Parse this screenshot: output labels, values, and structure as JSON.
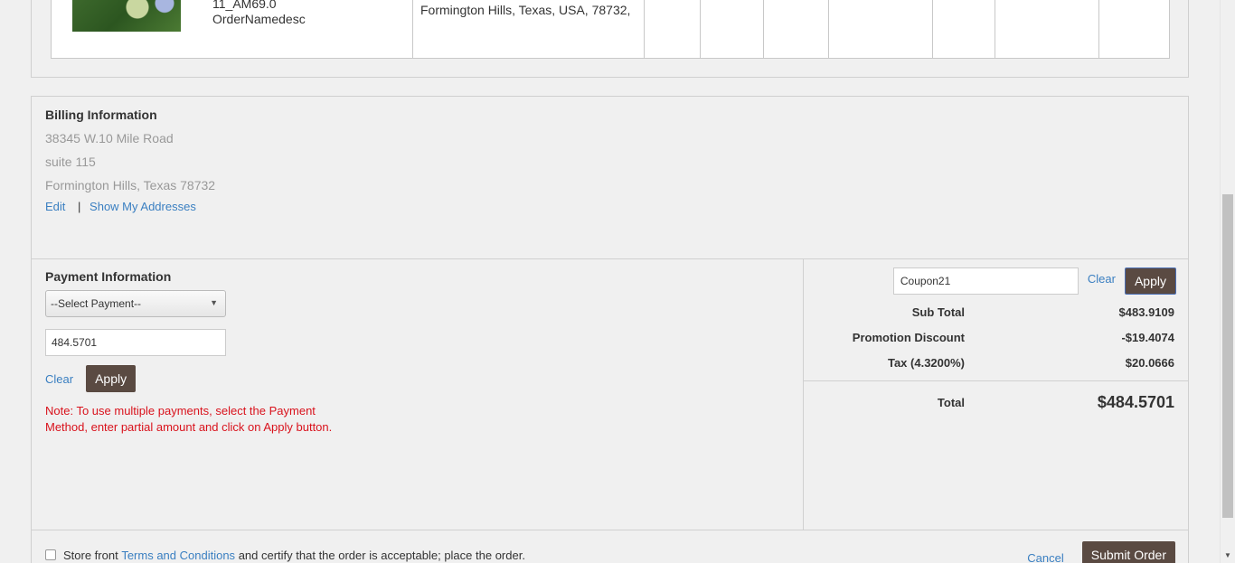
{
  "order": {
    "product_line1": "11_AM69.0",
    "product_line2": "OrderNamedesc",
    "address": "Formington Hills, Texas, USA, 78732,"
  },
  "billing": {
    "title": "Billing Information",
    "address1": "38345 W.10 Mile Road",
    "address2": "suite 115",
    "city_state_zip": "Formington Hills, Texas 78732",
    "edit_label": "Edit",
    "separator": "|",
    "show_addresses_label": "Show My Addresses"
  },
  "payment": {
    "title": "Payment Information",
    "select_value": "--Select Payment--",
    "amount_value": "484.5701",
    "clear_label": "Clear",
    "apply_label": "Apply",
    "note": "Note: To use multiple payments, select the Payment Method, enter partial amount and click on Apply button."
  },
  "summary": {
    "coupon_value": "Coupon21",
    "clear_label": "Clear",
    "apply_label": "Apply",
    "rows": [
      {
        "label": "Sub Total",
        "value": "$483.9109"
      },
      {
        "label": "Promotion Discount",
        "value": "-$19.4074"
      },
      {
        "label": "Tax (4.3200%)",
        "value": "$20.0666"
      }
    ],
    "total_label": "Total",
    "total_value": "$484.5701"
  },
  "footer": {
    "prefix": "Store front",
    "terms_label": "Terms and Conditions",
    "suffix": "and certify that the order is acceptable; place the order.",
    "cancel_label": "Cancel",
    "submit_label": "Submit Order"
  },
  "colors": {
    "accent_link": "#3a7fc1",
    "button_dark": "#5a4a42",
    "note_red": "#d9121c"
  }
}
